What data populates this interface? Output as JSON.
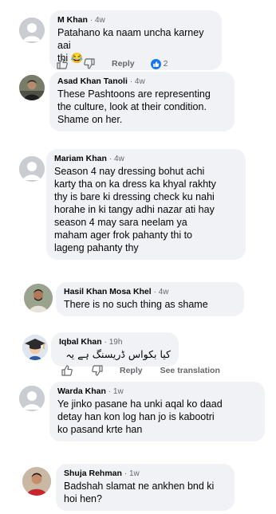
{
  "comments": [
    {
      "name": "M Khan",
      "time": "· 4w",
      "text_lines": [
        "Patahano ka naam uncha karney aai",
        "thi 😂"
      ],
      "actions": {
        "reply": "Reply",
        "reaction_count": "2"
      }
    },
    {
      "name": "Asad Khan Tanoli",
      "time": "· 4w",
      "text_lines": [
        "These Pashtoons are representing",
        "the culture, look at their condition.",
        "Shame on her."
      ]
    },
    {
      "name": "Mariam Khan",
      "time": "· 4w",
      "text_lines": [
        "Season 4 nay dressing bohut achi",
        "karty tha on ka dress ka khyal rakhty",
        "thy is bare ki dressing check ku nahi",
        "horahe in ki tangy adhi nazar ati hay",
        "season 4 may sara neelam ya",
        "maham ager frok pahanty thi to",
        "lageng pahanty thy"
      ]
    },
    {
      "name": "Hasil Khan Mosa Khel",
      "time": "· 4w",
      "text_lines": [
        "There is no such thing as shame"
      ]
    },
    {
      "name": "Iqbal Khan",
      "time": "· 19h",
      "text_lines": [
        "کیا بکواس ڈریسنگ ہے یہ"
      ],
      "actions": {
        "reply": "Reply",
        "see_translation": "See translation"
      }
    },
    {
      "name": "Warda Khan",
      "time": "· 1w",
      "text_lines": [
        "Ye jinko pasane ha unki aqal ko daad",
        "detay han kon log han jo is kabootri",
        "ko pasand krte han"
      ]
    },
    {
      "name": "Shuja Rehman",
      "time": "· 1w",
      "text_lines": [
        "Badshah slamat ne ankhen bnd ki",
        "hoi hen?"
      ]
    }
  ],
  "icons": {
    "like": "thumbs-up-icon",
    "dislike": "thumbs-down-icon",
    "reaction": "like-reaction-icon",
    "default_avatar": "default-profile-icon"
  },
  "colors": {
    "bubble": "#f0f2f5",
    "meta": "#65676b",
    "like_blue": "#1877f2"
  }
}
